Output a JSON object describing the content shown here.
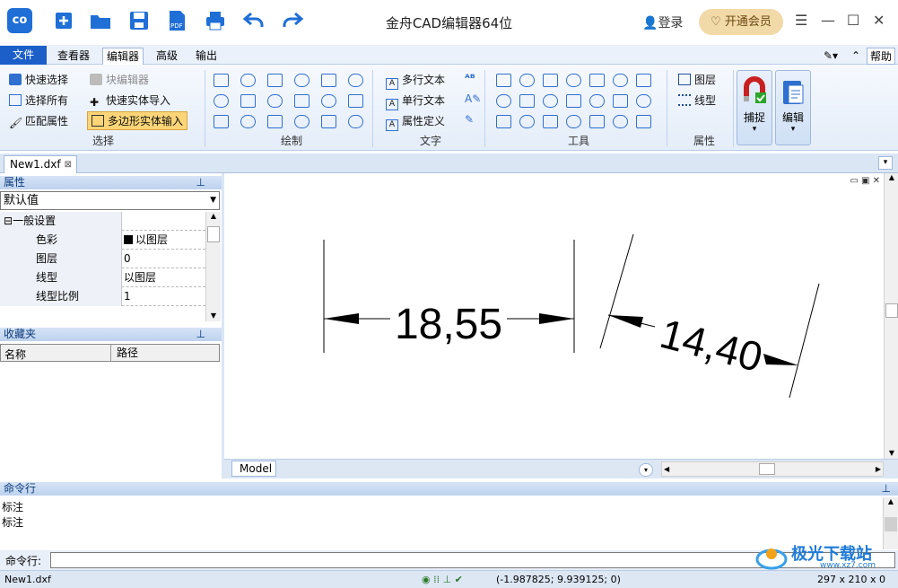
{
  "app": {
    "title": "金舟CAD编辑器64位",
    "logo": "co",
    "login": "登录",
    "vip": "开通会员"
  },
  "tabs": [
    "文件",
    "查看器",
    "编辑器",
    "高级",
    "输出"
  ],
  "help": "帮助",
  "ribbon": {
    "select": {
      "label": "选择",
      "items": [
        "快速选择",
        "选择所有",
        "匹配属性",
        "块编辑器",
        "快速实体导入",
        "多边形实体输入"
      ]
    },
    "draw": {
      "label": "绘制"
    },
    "text": {
      "label": "文字",
      "items": [
        "多行文本",
        "单行文本",
        "属性定义"
      ]
    },
    "tools": {
      "label": "工具"
    },
    "props": {
      "label": "属性",
      "items": [
        "图层",
        "线型"
      ]
    },
    "snap": "捕捉",
    "edit": "编辑"
  },
  "doc_tab": "New1.dxf",
  "props_panel": {
    "title": "属性",
    "dropdown": "默认值",
    "group": "一般设置",
    "rows": [
      [
        "色彩",
        "以图层"
      ],
      [
        "图层",
        "0"
      ],
      [
        "线型",
        "以图层"
      ],
      [
        "线型比例",
        "1"
      ]
    ]
  },
  "fav_panel": {
    "title": "收藏夹",
    "cols": [
      "名称",
      "路径"
    ]
  },
  "drawing": {
    "dim1": "18,55",
    "dim2": "14,40"
  },
  "model_tab": "Model",
  "cmdline": {
    "title": "命令行",
    "lines": [
      "标注",
      "标注"
    ],
    "label": "命令行:",
    "value": ""
  },
  "status": {
    "file": "New1.dxf",
    "coords": "(-1.987825; 9.939125; 0)",
    "paper": "297 x 210 x 0"
  },
  "watermark": {
    "text": "极光下载站",
    "url": "www.xz7.com"
  }
}
